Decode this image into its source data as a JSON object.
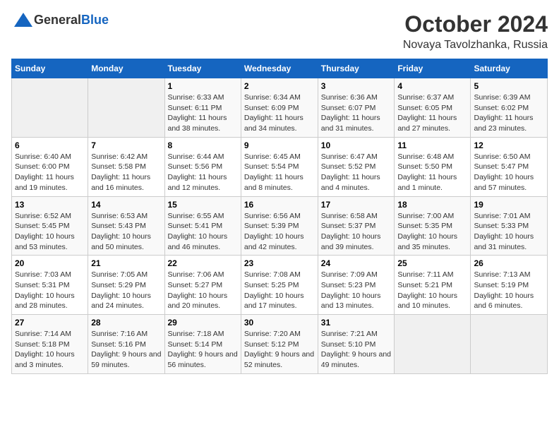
{
  "logo": {
    "general": "General",
    "blue": "Blue"
  },
  "title": "October 2024",
  "location": "Novaya Tavolzhanka, Russia",
  "days_of_week": [
    "Sunday",
    "Monday",
    "Tuesday",
    "Wednesday",
    "Thursday",
    "Friday",
    "Saturday"
  ],
  "weeks": [
    [
      {
        "num": "",
        "sunrise": "",
        "sunset": "",
        "daylight": ""
      },
      {
        "num": "",
        "sunrise": "",
        "sunset": "",
        "daylight": ""
      },
      {
        "num": "1",
        "sunrise": "Sunrise: 6:33 AM",
        "sunset": "Sunset: 6:11 PM",
        "daylight": "Daylight: 11 hours and 38 minutes."
      },
      {
        "num": "2",
        "sunrise": "Sunrise: 6:34 AM",
        "sunset": "Sunset: 6:09 PM",
        "daylight": "Daylight: 11 hours and 34 minutes."
      },
      {
        "num": "3",
        "sunrise": "Sunrise: 6:36 AM",
        "sunset": "Sunset: 6:07 PM",
        "daylight": "Daylight: 11 hours and 31 minutes."
      },
      {
        "num": "4",
        "sunrise": "Sunrise: 6:37 AM",
        "sunset": "Sunset: 6:05 PM",
        "daylight": "Daylight: 11 hours and 27 minutes."
      },
      {
        "num": "5",
        "sunrise": "Sunrise: 6:39 AM",
        "sunset": "Sunset: 6:02 PM",
        "daylight": "Daylight: 11 hours and 23 minutes."
      }
    ],
    [
      {
        "num": "6",
        "sunrise": "Sunrise: 6:40 AM",
        "sunset": "Sunset: 6:00 PM",
        "daylight": "Daylight: 11 hours and 19 minutes."
      },
      {
        "num": "7",
        "sunrise": "Sunrise: 6:42 AM",
        "sunset": "Sunset: 5:58 PM",
        "daylight": "Daylight: 11 hours and 16 minutes."
      },
      {
        "num": "8",
        "sunrise": "Sunrise: 6:44 AM",
        "sunset": "Sunset: 5:56 PM",
        "daylight": "Daylight: 11 hours and 12 minutes."
      },
      {
        "num": "9",
        "sunrise": "Sunrise: 6:45 AM",
        "sunset": "Sunset: 5:54 PM",
        "daylight": "Daylight: 11 hours and 8 minutes."
      },
      {
        "num": "10",
        "sunrise": "Sunrise: 6:47 AM",
        "sunset": "Sunset: 5:52 PM",
        "daylight": "Daylight: 11 hours and 4 minutes."
      },
      {
        "num": "11",
        "sunrise": "Sunrise: 6:48 AM",
        "sunset": "Sunset: 5:50 PM",
        "daylight": "Daylight: 11 hours and 1 minute."
      },
      {
        "num": "12",
        "sunrise": "Sunrise: 6:50 AM",
        "sunset": "Sunset: 5:47 PM",
        "daylight": "Daylight: 10 hours and 57 minutes."
      }
    ],
    [
      {
        "num": "13",
        "sunrise": "Sunrise: 6:52 AM",
        "sunset": "Sunset: 5:45 PM",
        "daylight": "Daylight: 10 hours and 53 minutes."
      },
      {
        "num": "14",
        "sunrise": "Sunrise: 6:53 AM",
        "sunset": "Sunset: 5:43 PM",
        "daylight": "Daylight: 10 hours and 50 minutes."
      },
      {
        "num": "15",
        "sunrise": "Sunrise: 6:55 AM",
        "sunset": "Sunset: 5:41 PM",
        "daylight": "Daylight: 10 hours and 46 minutes."
      },
      {
        "num": "16",
        "sunrise": "Sunrise: 6:56 AM",
        "sunset": "Sunset: 5:39 PM",
        "daylight": "Daylight: 10 hours and 42 minutes."
      },
      {
        "num": "17",
        "sunrise": "Sunrise: 6:58 AM",
        "sunset": "Sunset: 5:37 PM",
        "daylight": "Daylight: 10 hours and 39 minutes."
      },
      {
        "num": "18",
        "sunrise": "Sunrise: 7:00 AM",
        "sunset": "Sunset: 5:35 PM",
        "daylight": "Daylight: 10 hours and 35 minutes."
      },
      {
        "num": "19",
        "sunrise": "Sunrise: 7:01 AM",
        "sunset": "Sunset: 5:33 PM",
        "daylight": "Daylight: 10 hours and 31 minutes."
      }
    ],
    [
      {
        "num": "20",
        "sunrise": "Sunrise: 7:03 AM",
        "sunset": "Sunset: 5:31 PM",
        "daylight": "Daylight: 10 hours and 28 minutes."
      },
      {
        "num": "21",
        "sunrise": "Sunrise: 7:05 AM",
        "sunset": "Sunset: 5:29 PM",
        "daylight": "Daylight: 10 hours and 24 minutes."
      },
      {
        "num": "22",
        "sunrise": "Sunrise: 7:06 AM",
        "sunset": "Sunset: 5:27 PM",
        "daylight": "Daylight: 10 hours and 20 minutes."
      },
      {
        "num": "23",
        "sunrise": "Sunrise: 7:08 AM",
        "sunset": "Sunset: 5:25 PM",
        "daylight": "Daylight: 10 hours and 17 minutes."
      },
      {
        "num": "24",
        "sunrise": "Sunrise: 7:09 AM",
        "sunset": "Sunset: 5:23 PM",
        "daylight": "Daylight: 10 hours and 13 minutes."
      },
      {
        "num": "25",
        "sunrise": "Sunrise: 7:11 AM",
        "sunset": "Sunset: 5:21 PM",
        "daylight": "Daylight: 10 hours and 10 minutes."
      },
      {
        "num": "26",
        "sunrise": "Sunrise: 7:13 AM",
        "sunset": "Sunset: 5:19 PM",
        "daylight": "Daylight: 10 hours and 6 minutes."
      }
    ],
    [
      {
        "num": "27",
        "sunrise": "Sunrise: 7:14 AM",
        "sunset": "Sunset: 5:18 PM",
        "daylight": "Daylight: 10 hours and 3 minutes."
      },
      {
        "num": "28",
        "sunrise": "Sunrise: 7:16 AM",
        "sunset": "Sunset: 5:16 PM",
        "daylight": "Daylight: 9 hours and 59 minutes."
      },
      {
        "num": "29",
        "sunrise": "Sunrise: 7:18 AM",
        "sunset": "Sunset: 5:14 PM",
        "daylight": "Daylight: 9 hours and 56 minutes."
      },
      {
        "num": "30",
        "sunrise": "Sunrise: 7:20 AM",
        "sunset": "Sunset: 5:12 PM",
        "daylight": "Daylight: 9 hours and 52 minutes."
      },
      {
        "num": "31",
        "sunrise": "Sunrise: 7:21 AM",
        "sunset": "Sunset: 5:10 PM",
        "daylight": "Daylight: 9 hours and 49 minutes."
      },
      {
        "num": "",
        "sunrise": "",
        "sunset": "",
        "daylight": ""
      },
      {
        "num": "",
        "sunrise": "",
        "sunset": "",
        "daylight": ""
      }
    ]
  ]
}
